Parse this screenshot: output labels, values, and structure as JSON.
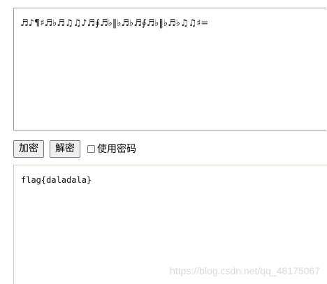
{
  "input": {
    "value": "♬♪¶♯♬♭♬♫♫♪♬∮♬♭‖♭♬♭♬∮♬♭‖♭♬♭♫♫♯="
  },
  "controls": {
    "encrypt_label": "加密",
    "decrypt_label": "解密",
    "use_password_label": "使用密码",
    "use_password_checked": false
  },
  "output": {
    "value": "flag{daladala}"
  },
  "watermark": "https://blog.csdn.net/qq_48175067"
}
